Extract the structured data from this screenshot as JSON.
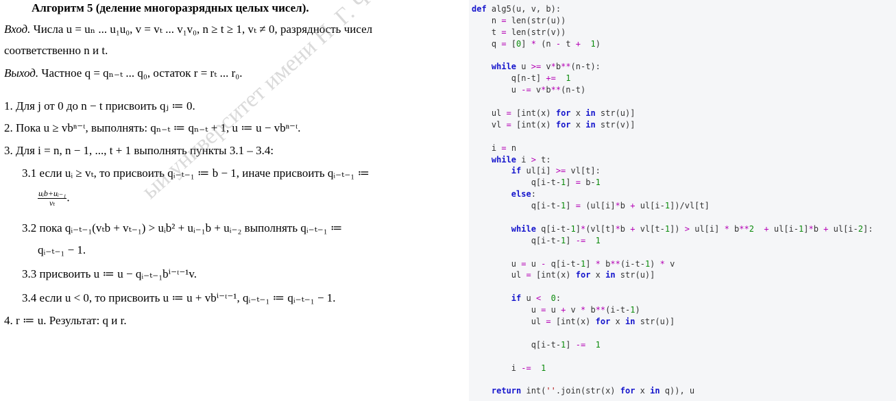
{
  "algorithm": {
    "title": "Алгоритм 5 (деление многоразрядных целых чисел).",
    "input_label": "Вход.",
    "input_text_1": " Числа u = uₙ ... u₁u₀, v = vₜ ... v₁v₀, n ≥ t ≥ 1, vₜ ≠ 0, разрядность чисел",
    "input_text_2": "соответственно n и t.",
    "output_label": "Выход.",
    "output_text": " Частное q = qₙ₋ₜ ... q₀, остаток r = rₜ ... r₀.",
    "steps": {
      "s1": "1. Для j от 0 до n − t присвоить qⱼ ≔ 0.",
      "s2": "2. Пока u ≥ vbⁿ⁻ᵗ, выполнять: qₙ₋ₜ ≔ qₙ₋ₜ + 1, u ≔ u − vbⁿ⁻ᵗ.",
      "s3": "3. Для i = n, n − 1, ..., t + 1 выполнять пункты 3.1 – 3.4:",
      "s31_line1": "3.1 если  uᵢ ≥ vₜ,  то  присвоить  qᵢ₋ₜ₋₁ ≔ b − 1,  иначе  присвоить  qᵢ₋ₜ₋₁ ≔",
      "s31_frac_num": "uᵢb+uᵢ₋₁",
      "s31_frac_den": "vₜ",
      "s31_end": ".",
      "s32_line1": "3.2 пока      qᵢ₋ₜ₋₁(vₜb + vₜ₋₁) > uᵢb² + uᵢ₋₁b + uᵢ₋₂       выполнять       qᵢ₋ₜ₋₁ ≔",
      "s32_line2": "qᵢ₋ₜ₋₁ − 1.",
      "s33": "3.3 присвоить u ≔ u − qᵢ₋ₜ₋₁bⁱ⁻ᵗ⁻¹v.",
      "s34": "3.4 если u < 0, то присвоить u ≔ u + vbⁱ⁻ᵗ⁻¹, qᵢ₋ₜ₋₁ ≔ qᵢ₋ₜ₋₁ − 1.",
      "s4": "4.  r ≔ u. Результат: q и r."
    },
    "watermark": "ый университет имени Н. Г. Чернышевского"
  },
  "code": {
    "lines": [
      [
        [
          "kw",
          "def"
        ],
        [
          "",
          "  alg5(u, v, b):"
        ]
      ],
      [
        [
          "",
          "    n "
        ],
        [
          "op",
          "="
        ],
        [
          "",
          "  len(str(u))"
        ]
      ],
      [
        [
          "",
          "    t "
        ],
        [
          "op",
          "="
        ],
        [
          "",
          "  len(str(v))"
        ]
      ],
      [
        [
          "",
          "    q "
        ],
        [
          "op",
          "="
        ],
        [
          "",
          "  ["
        ],
        [
          "nm",
          "0"
        ],
        [
          "",
          "] "
        ],
        [
          "op",
          "*"
        ],
        [
          "",
          "  (n "
        ],
        [
          "op",
          "-"
        ],
        [
          "",
          "  t "
        ],
        [
          "op",
          "+"
        ],
        [
          "",
          "  "
        ],
        [
          "nm",
          "1"
        ],
        [
          "",
          ")"
        ]
      ],
      [
        [
          "",
          ""
        ]
      ],
      [
        [
          "kw",
          "    while"
        ],
        [
          "",
          "  u "
        ],
        [
          "op",
          ">="
        ],
        [
          "",
          "  v"
        ],
        [
          "op",
          "*"
        ],
        [
          "",
          "b"
        ],
        [
          "op",
          "**"
        ],
        [
          "",
          "(n-t):"
        ]
      ],
      [
        [
          "",
          "        q[n-t] "
        ],
        [
          "op",
          "+="
        ],
        [
          "",
          "  "
        ],
        [
          "nm",
          "1"
        ]
      ],
      [
        [
          "",
          "        u "
        ],
        [
          "op",
          "-="
        ],
        [
          "",
          "  v"
        ],
        [
          "op",
          "*"
        ],
        [
          "",
          "b"
        ],
        [
          "op",
          "**"
        ],
        [
          "",
          "(n-t)"
        ]
      ],
      [
        [
          "",
          ""
        ]
      ],
      [
        [
          "",
          "    ul "
        ],
        [
          "op",
          "="
        ],
        [
          "",
          "  [int(x) "
        ],
        [
          "kw",
          "for"
        ],
        [
          "",
          "  x "
        ],
        [
          "kw",
          "in"
        ],
        [
          "",
          "  str(u)]"
        ]
      ],
      [
        [
          "",
          "    vl "
        ],
        [
          "op",
          "="
        ],
        [
          "",
          "  [int(x) "
        ],
        [
          "kw",
          "for"
        ],
        [
          "",
          "  x "
        ],
        [
          "kw",
          "in"
        ],
        [
          "",
          "  str(v)]"
        ]
      ],
      [
        [
          "",
          ""
        ]
      ],
      [
        [
          "",
          "    i "
        ],
        [
          "op",
          "="
        ],
        [
          "",
          "  n"
        ]
      ],
      [
        [
          "kw",
          "    while"
        ],
        [
          "",
          "  i "
        ],
        [
          "op",
          ">"
        ],
        [
          "",
          "  t:"
        ]
      ],
      [
        [
          "kw",
          "        if"
        ],
        [
          "",
          "  ul[i] "
        ],
        [
          "op",
          ">="
        ],
        [
          "",
          "  vl[t]:"
        ]
      ],
      [
        [
          "",
          "            q[i-t-"
        ],
        [
          "nm",
          "1"
        ],
        [
          "",
          "] "
        ],
        [
          "op",
          "="
        ],
        [
          "",
          "  b-"
        ],
        [
          "nm",
          "1"
        ]
      ],
      [
        [
          "kw",
          "        else"
        ],
        [
          "",
          ":"
        ]
      ],
      [
        [
          "",
          "            q[i-t-"
        ],
        [
          "nm",
          "1"
        ],
        [
          "",
          "] "
        ],
        [
          "op",
          "="
        ],
        [
          "",
          "  (ul[i]"
        ],
        [
          "op",
          "*"
        ],
        [
          "",
          "b "
        ],
        [
          "op",
          "+"
        ],
        [
          "",
          "  ul[i-"
        ],
        [
          "nm",
          "1"
        ],
        [
          "",
          "])/vl[t]"
        ]
      ],
      [
        [
          "",
          ""
        ]
      ],
      [
        [
          "kw",
          "        while"
        ],
        [
          "",
          "  q[i-t-"
        ],
        [
          "nm",
          "1"
        ],
        [
          "",
          "]"
        ],
        [
          "op",
          "*"
        ],
        [
          "",
          "(vl[t]"
        ],
        [
          "op",
          "*"
        ],
        [
          "",
          "b "
        ],
        [
          "op",
          "+"
        ],
        [
          "",
          "  vl[t-"
        ],
        [
          "nm",
          "1"
        ],
        [
          "",
          "]) "
        ],
        [
          "op",
          ">"
        ],
        [
          "",
          "  ul[i] "
        ],
        [
          "op",
          "*"
        ],
        [
          "",
          "  b"
        ],
        [
          "op",
          "**"
        ],
        [
          "nm",
          "2"
        ],
        [
          "",
          "  "
        ],
        [
          "op",
          "+"
        ],
        [
          "",
          "  ul[i-"
        ],
        [
          "nm",
          "1"
        ],
        [
          "",
          "]"
        ],
        [
          "op",
          "*"
        ],
        [
          "",
          "b "
        ],
        [
          "op",
          "+"
        ],
        [
          "",
          "  ul[i-"
        ],
        [
          "nm",
          "2"
        ],
        [
          "",
          "]:"
        ]
      ],
      [
        [
          "",
          "            q[i-t-"
        ],
        [
          "nm",
          "1"
        ],
        [
          "",
          "] "
        ],
        [
          "op",
          "-="
        ],
        [
          "",
          "  "
        ],
        [
          "nm",
          "1"
        ]
      ],
      [
        [
          "",
          ""
        ]
      ],
      [
        [
          "",
          "        u "
        ],
        [
          "op",
          "="
        ],
        [
          "",
          "  u "
        ],
        [
          "op",
          "-"
        ],
        [
          "",
          "  q[i-t-"
        ],
        [
          "nm",
          "1"
        ],
        [
          "",
          "] "
        ],
        [
          "op",
          "*"
        ],
        [
          "",
          "  b"
        ],
        [
          "op",
          "**"
        ],
        [
          "",
          "(i-t-"
        ],
        [
          "nm",
          "1"
        ],
        [
          "",
          ") "
        ],
        [
          "op",
          "*"
        ],
        [
          "",
          "  v"
        ]
      ],
      [
        [
          "",
          "        ul "
        ],
        [
          "op",
          "="
        ],
        [
          "",
          "  [int(x) "
        ],
        [
          "kw",
          "for"
        ],
        [
          "",
          "  x "
        ],
        [
          "kw",
          "in"
        ],
        [
          "",
          "  str(u)]"
        ]
      ],
      [
        [
          "",
          ""
        ]
      ],
      [
        [
          "kw",
          "        if"
        ],
        [
          "",
          "  u "
        ],
        [
          "op",
          "<"
        ],
        [
          "",
          "  "
        ],
        [
          "nm",
          "0"
        ],
        [
          "",
          ":"
        ]
      ],
      [
        [
          "",
          "            u "
        ],
        [
          "op",
          "="
        ],
        [
          "",
          "  u "
        ],
        [
          "op",
          "+"
        ],
        [
          "",
          "  v "
        ],
        [
          "op",
          "*"
        ],
        [
          "",
          "  b"
        ],
        [
          "op",
          "**"
        ],
        [
          "",
          "(i-t-"
        ],
        [
          "nm",
          "1"
        ],
        [
          "",
          ")"
        ]
      ],
      [
        [
          "",
          "            ul "
        ],
        [
          "op",
          "="
        ],
        [
          "",
          "  [int(x) "
        ],
        [
          "kw",
          "for"
        ],
        [
          "",
          "  x "
        ],
        [
          "kw",
          "in"
        ],
        [
          "",
          "  str(u)]"
        ]
      ],
      [
        [
          "",
          ""
        ]
      ],
      [
        [
          "",
          "            q[i-t-"
        ],
        [
          "nm",
          "1"
        ],
        [
          "",
          "] "
        ],
        [
          "op",
          "-="
        ],
        [
          "",
          "  "
        ],
        [
          "nm",
          "1"
        ]
      ],
      [
        [
          "",
          ""
        ]
      ],
      [
        [
          "",
          "        i "
        ],
        [
          "op",
          "-="
        ],
        [
          "",
          "  "
        ],
        [
          "nm",
          "1"
        ]
      ],
      [
        [
          "",
          ""
        ]
      ],
      [
        [
          "kw",
          "    return"
        ],
        [
          "",
          "  int("
        ],
        [
          "st",
          "''"
        ],
        [
          "",
          ".join(str(x) "
        ],
        [
          "kw",
          "for"
        ],
        [
          "",
          "  x "
        ],
        [
          "kw",
          "in"
        ],
        [
          "",
          "  q)), u"
        ]
      ]
    ]
  }
}
